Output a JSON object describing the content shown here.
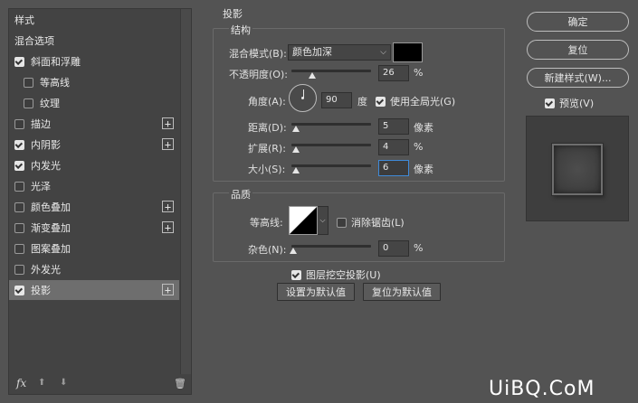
{
  "left_panel": {
    "items": [
      {
        "label": "样式",
        "checkbox": false,
        "checked": false,
        "plus": false,
        "indent": false,
        "selected": false
      },
      {
        "label": "混合选项",
        "checkbox": false,
        "checked": false,
        "plus": false,
        "indent": false,
        "selected": false
      },
      {
        "label": "斜面和浮雕",
        "checkbox": true,
        "checked": true,
        "plus": false,
        "indent": false,
        "selected": false
      },
      {
        "label": "等高线",
        "checkbox": true,
        "checked": false,
        "plus": false,
        "indent": true,
        "selected": false
      },
      {
        "label": "纹理",
        "checkbox": true,
        "checked": false,
        "plus": false,
        "indent": true,
        "selected": false
      },
      {
        "label": "描边",
        "checkbox": true,
        "checked": false,
        "plus": true,
        "indent": false,
        "selected": false
      },
      {
        "label": "内阴影",
        "checkbox": true,
        "checked": true,
        "plus": true,
        "indent": false,
        "selected": false
      },
      {
        "label": "内发光",
        "checkbox": true,
        "checked": true,
        "plus": false,
        "indent": false,
        "selected": false
      },
      {
        "label": "光泽",
        "checkbox": true,
        "checked": false,
        "plus": false,
        "indent": false,
        "selected": false
      },
      {
        "label": "颜色叠加",
        "checkbox": true,
        "checked": false,
        "plus": true,
        "indent": false,
        "selected": false
      },
      {
        "label": "渐变叠加",
        "checkbox": true,
        "checked": false,
        "plus": true,
        "indent": false,
        "selected": false
      },
      {
        "label": "图案叠加",
        "checkbox": true,
        "checked": false,
        "plus": false,
        "indent": false,
        "selected": false
      },
      {
        "label": "外发光",
        "checkbox": true,
        "checked": false,
        "plus": false,
        "indent": false,
        "selected": false
      },
      {
        "label": "投影",
        "checkbox": true,
        "checked": true,
        "plus": true,
        "indent": false,
        "selected": true
      }
    ],
    "footer": {
      "fx": "fx",
      "up": "⬆",
      "down": "⬇",
      "trash": "🗑"
    }
  },
  "drop_shadow": {
    "title": "投影",
    "structure": {
      "title": "结构",
      "blend_mode_label": "混合模式(B):",
      "blend_mode_value": "颜色加深",
      "shadow_color": "#000000",
      "opacity_label": "不透明度(O):",
      "opacity_value": "26",
      "opacity_unit": "%",
      "opacity_fraction": 0.26,
      "angle_label": "角度(A):",
      "angle_value": "90",
      "angle_unit": "度",
      "global_light_label": "使用全局光(G)",
      "global_light_checked": true,
      "distance_label": "距离(D):",
      "distance_value": "5",
      "distance_unit": "像素",
      "spread_label": "扩展(R):",
      "spread_value": "4",
      "spread_unit": "%",
      "size_label": "大小(S):",
      "size_value": "6",
      "size_unit": "像素"
    },
    "quality": {
      "title": "品质",
      "contour_label": "等高线:",
      "anti_alias_label": "消除锯齿(L)",
      "anti_alias_checked": false,
      "noise_label": "杂色(N):",
      "noise_value": "0",
      "noise_unit": "%"
    },
    "knockout_label": "图层挖空投影(U)",
    "knockout_checked": true,
    "make_default_label": "设置为默认值",
    "reset_default_label": "复位为默认值"
  },
  "right_panel": {
    "ok_label": "确定",
    "reset_label": "复位",
    "new_style_label": "新建样式(W)...",
    "preview_label": "预览(V)",
    "preview_checked": true
  },
  "watermark": "UiBQ.CoM"
}
